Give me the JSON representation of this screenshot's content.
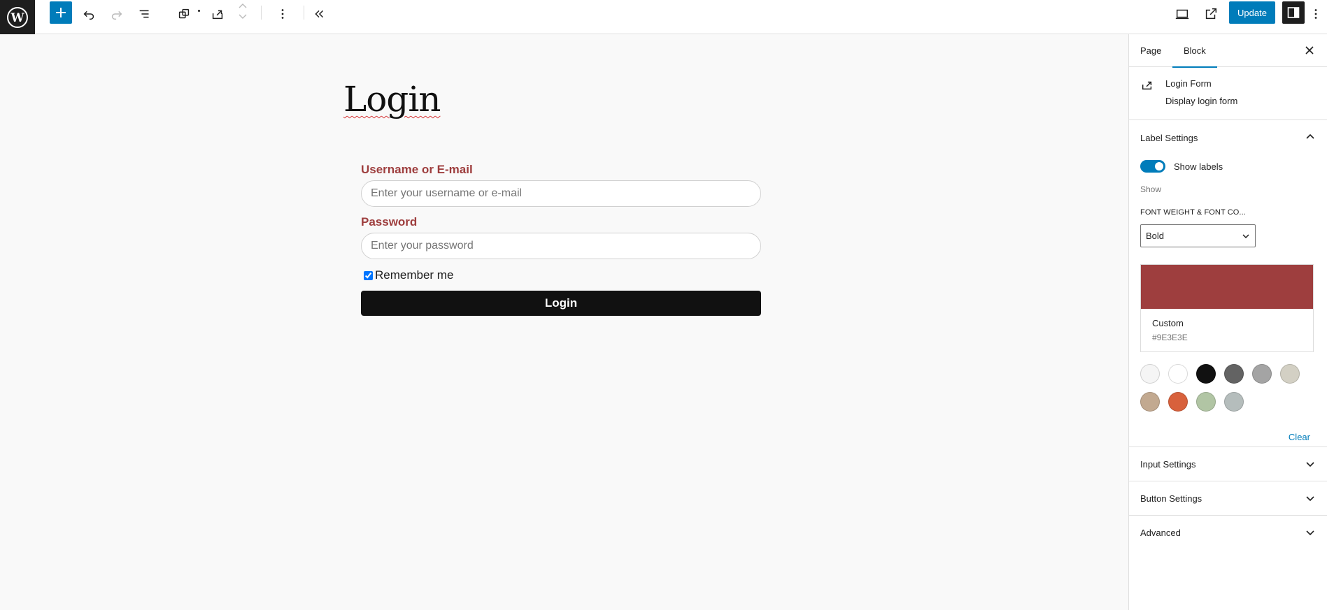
{
  "toolbar": {
    "update_label": "Update",
    "icons": [
      "wordpress-logo",
      "plus",
      "undo",
      "redo",
      "list-view",
      "block-pattern",
      "share",
      "mover",
      "more-vertical",
      "collapse",
      "desktop-preview",
      "external-link",
      "sidebar-toggle",
      "more-vertical"
    ]
  },
  "canvas": {
    "page_title": "Login",
    "form": {
      "username_label": "Username or E-mail",
      "username_placeholder": "Enter your username or e-mail",
      "password_label": "Password",
      "password_placeholder": "Enter your password",
      "remember_label": "Remember me",
      "remember_checked": true,
      "submit_label": "Login"
    }
  },
  "sidebar": {
    "tabs": [
      {
        "label": "Page",
        "active": false
      },
      {
        "label": "Block",
        "active": true
      }
    ],
    "block": {
      "name": "Login Form",
      "description": "Display login form"
    },
    "label_settings": {
      "title": "Label Settings",
      "toggle_label": "Show labels",
      "toggle_on": true,
      "help": "Show",
      "font_weight_label": "FONT WEIGHT & FONT CO...",
      "font_weight_value": "Bold",
      "color_name": "Custom",
      "color_hex": "#9E3E3E",
      "palette": [
        "#f5f5f5",
        "#ffffff",
        "#111111",
        "#636363",
        "#a4a4a4",
        "#d3d0c4",
        "#c2a990",
        "#d8613c",
        "#b1c5a4",
        "#b5bdbc"
      ],
      "clear_label": "Clear"
    },
    "sections": [
      {
        "title": "Input Settings"
      },
      {
        "title": "Button Settings"
      },
      {
        "title": "Advanced"
      }
    ]
  },
  "colors": {
    "accent": "#007cba",
    "label_color": "#9e3e3e",
    "dark": "#1e1e1e"
  }
}
